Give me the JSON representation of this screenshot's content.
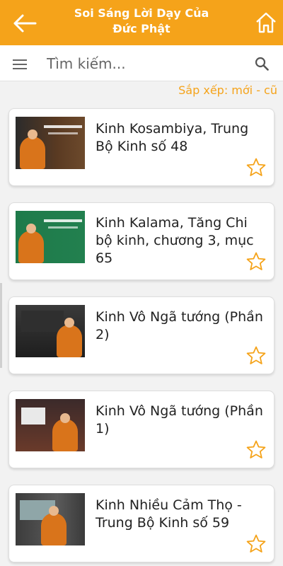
{
  "app": {
    "title_line1": "Soi Sáng Lời Dạy Của",
    "title_line2": "Đức Phật",
    "accent": "#f5a31a"
  },
  "icons": {
    "back": "arrow-left-icon",
    "home": "home-icon",
    "menu": "hamburger-menu-icon",
    "search": "search-icon",
    "favorite": "star-outline-icon"
  },
  "search": {
    "placeholder": "Tìm kiếm...",
    "value": ""
  },
  "sort": {
    "label": "Sắp xếp: mới - cũ"
  },
  "items": [
    {
      "title": "Kinh Kosambiya, Trung Bộ Kinh số 48",
      "favorite": false
    },
    {
      "title": "Kinh Kalama, Tăng Chi bộ kinh, chương 3, mục 65",
      "favorite": false
    },
    {
      "title": "Kinh Vô Ngã tướng (Phần 2)",
      "favorite": false
    },
    {
      "title": "Kinh Vô Ngã tướng (Phần 1)",
      "favorite": false
    },
    {
      "title": "Kinh Nhiều Cảm Thọ - Trung Bộ Kinh số 59",
      "favorite": false
    }
  ]
}
